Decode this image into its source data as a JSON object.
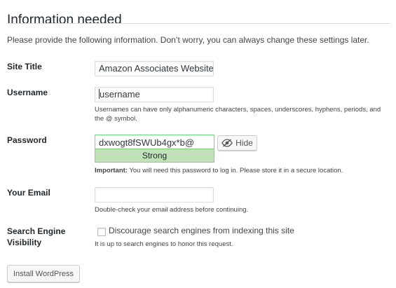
{
  "header": {
    "title": "Information needed",
    "intro": "Please provide the following information. Don’t worry, you can always change these settings later."
  },
  "form": {
    "site_title": {
      "label": "Site Title",
      "value": "Amazon Associates Website"
    },
    "username": {
      "label": "Username",
      "value": "username",
      "help": "Usernames can have only alphanumeric characters, spaces, underscores, hyphens, periods, and the @ symbol."
    },
    "password": {
      "label": "Password",
      "value": "dxwogt8fSWUb4gx*b@",
      "strength": "Strong",
      "hide_label": "Hide",
      "hide_icon": "eye-slash-icon",
      "important_label": "Important:",
      "important_text": " You will need this password to log in. Please store it in a secure location."
    },
    "email": {
      "label": "Your Email",
      "value": "",
      "help": "Double-check your email address before continuing."
    },
    "search_visibility": {
      "label_line1": "Search Engine",
      "label_line2": "Visibility",
      "checkbox_label": "Discourage search engines from indexing this site",
      "checked": false,
      "help": "It is up to search engines to honor this request."
    },
    "submit_label": "Install WordPress"
  },
  "colors": {
    "strength_bg": "#c1e1b9",
    "strength_border": "#68de7c"
  }
}
